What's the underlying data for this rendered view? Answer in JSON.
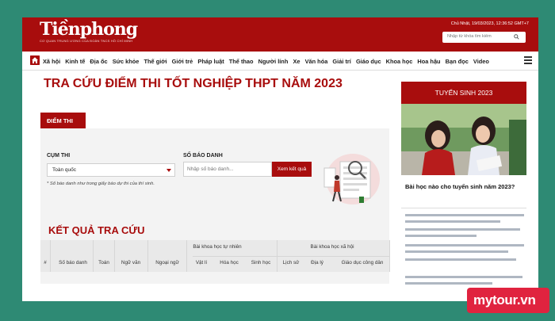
{
  "header": {
    "logo": "Tiềnphong",
    "logo_subtitle": "CƠ QUAN TRUNG ƯƠNG CỦA ĐOÀN TNCS HỒ CHÍ MINH",
    "dateline": "Chủ Nhật, 19/03/2023, 12:36:52 GMT+7",
    "search_placeholder": "Nhập từ khóa tìm kiếm",
    "brand_color": "#a80d0d"
  },
  "nav": {
    "items": [
      "Xã hội",
      "Kinh tế",
      "Địa ốc",
      "Sức khỏe",
      "Thế giới",
      "Giới trẻ",
      "Pháp luật",
      "Thể thao",
      "Người lính",
      "Xe",
      "Văn hóa",
      "Giải trí",
      "Giáo dục",
      "Khoa học",
      "Hoa hậu",
      "Bạn đọc",
      "Video"
    ]
  },
  "main": {
    "title": "TRA CỨU ĐIỂM THI TỐT NGHIỆP THPT NĂM 2023",
    "tab": "ĐIỂM THI",
    "cum_thi_label": "CỤM THI",
    "cum_thi_value": "Toàn quốc",
    "note": "* Số báo danh như trong giấy báo dự thi của thí sinh.",
    "sbd_label": "SỐ BÁO DANH",
    "sbd_placeholder": "Nhập số báo danh...",
    "search_button": "Xem kết quả",
    "results_title": "KẾT QUẢ TRA CỨU",
    "group_tn": "Bài khoa học tự nhiên",
    "group_xh": "Bài khoa học xã hội",
    "columns": [
      "#",
      "Số báo danh",
      "Toán",
      "Ngữ văn",
      "Ngoại ngữ",
      "Vật lí",
      "Hóa học",
      "Sinh học",
      "Lịch sử",
      "Địa lý",
      "Giáo dục công dân"
    ]
  },
  "sidebar": {
    "header": "TUYỂN SINH 2023",
    "article_title": "Bài học nào cho tuyển sinh năm 2023?"
  },
  "watermark": "mytour.vn"
}
